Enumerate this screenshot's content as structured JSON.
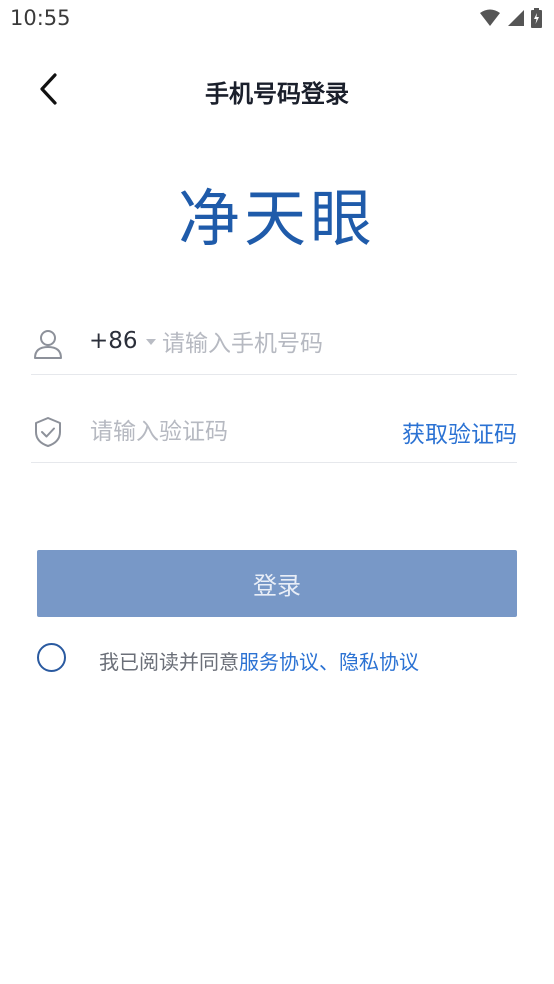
{
  "status_bar": {
    "time": "10:55"
  },
  "nav": {
    "title": "手机号码登录"
  },
  "logo": {
    "text": "净天眼"
  },
  "phone": {
    "country_code": "+86",
    "placeholder": "请输入手机号码",
    "value": ""
  },
  "code": {
    "placeholder": "请输入验证码",
    "value": "",
    "get_code_label": "获取验证码"
  },
  "login_button": {
    "label": "登录"
  },
  "agreement": {
    "prefix": "我已阅读并同意",
    "service_link": "服务协议",
    "separator": "、",
    "privacy_link": "隐私协议"
  },
  "colors": {
    "brand": "#1f5baa",
    "link": "#2b72d3",
    "button_disabled": "#7898c7"
  }
}
